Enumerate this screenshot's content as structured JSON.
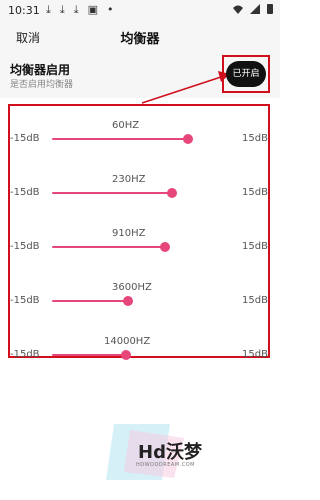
{
  "status_bar": {
    "time": "10:31",
    "icons": [
      "download-icon",
      "download-icon",
      "download-icon",
      "photo-icon",
      "dot-icon",
      "wifi-icon",
      "signal-icon",
      "battery-icon"
    ]
  },
  "header": {
    "cancel_label": "取消",
    "title": "均衡器"
  },
  "toggle": {
    "title": "均衡器启用",
    "subtitle": "是否启用均衡器",
    "button_label": "已开启",
    "enabled": true
  },
  "equalizer": {
    "accent_color": "#e7467a",
    "min_label": "-15dB",
    "max_label": "15dB",
    "bands": [
      {
        "freq": "60HZ",
        "level_fraction": 0.77
      },
      {
        "freq": "230HZ",
        "level_fraction": 0.68
      },
      {
        "freq": "910HZ",
        "level_fraction": 0.64
      },
      {
        "freq": "3600HZ",
        "level_fraction": 0.43
      },
      {
        "freq": "14000HZ",
        "level_fraction": 0.42
      }
    ]
  },
  "watermark": {
    "text": "Hd沃梦",
    "subtext": "HDWOODREAM.COM"
  }
}
